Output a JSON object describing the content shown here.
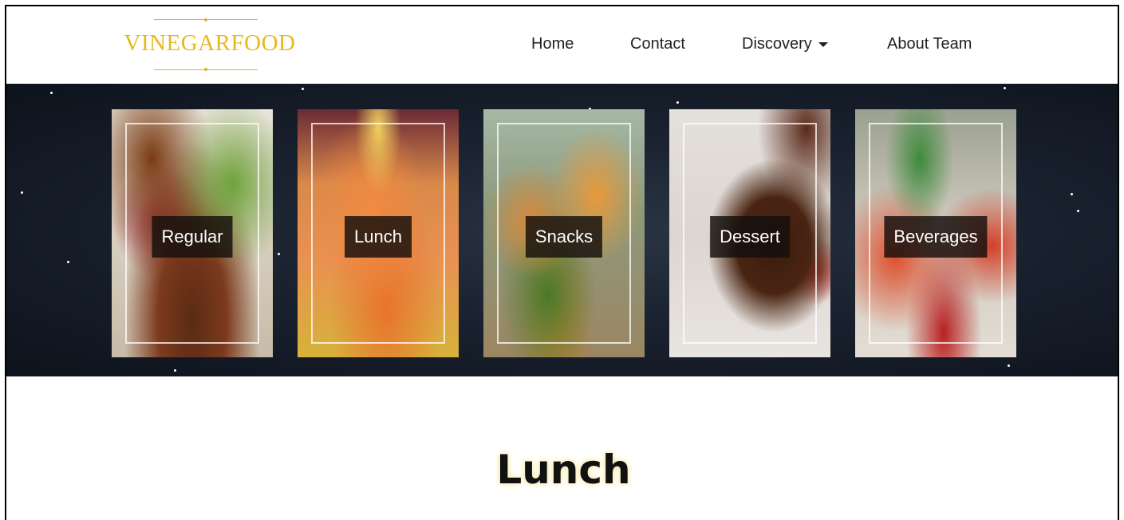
{
  "brand": {
    "name": "VINEGARFOOD",
    "color": "#e8b820"
  },
  "nav": {
    "home": "Home",
    "contact": "Contact",
    "discovery": "Discovery",
    "about": "About Team"
  },
  "categories": [
    {
      "label": "Regular",
      "image": "steak-and-salad-photo"
    },
    {
      "label": "Lunch",
      "image": "salmon-fillet-photo"
    },
    {
      "label": "Snacks",
      "image": "burgers-photo"
    },
    {
      "label": "Dessert",
      "image": "chocolate-lava-cake-photo"
    },
    {
      "label": "Beverages",
      "image": "strawberry-drinks-photo"
    }
  ],
  "section": {
    "title": "Lunch"
  }
}
